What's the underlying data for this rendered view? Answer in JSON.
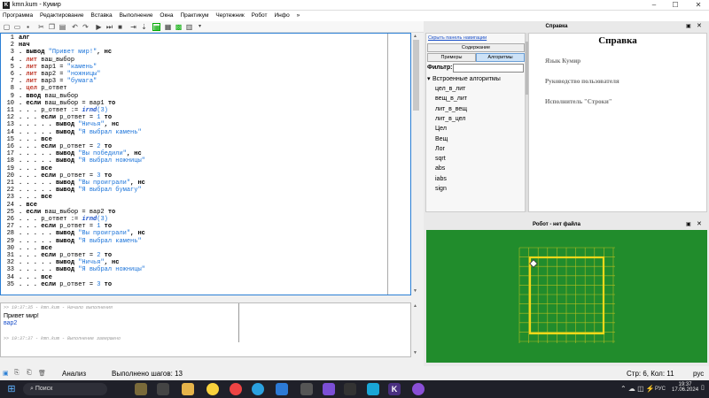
{
  "window": {
    "title": "kmn.kum - Кумир",
    "minimize": "–",
    "maximize": "☐",
    "close": "✕"
  },
  "menu": [
    "Программа",
    "Редактирование",
    "Вставка",
    "Выполнение",
    "Окна",
    "Практикум",
    "Чертежник",
    "Робот",
    "Инфо",
    "»"
  ],
  "editor": {
    "line_numbers": [
      "1",
      "2",
      "3",
      "4",
      "5",
      "6",
      "7",
      "8",
      "9",
      "10",
      "11",
      "12",
      "13",
      "14",
      "15",
      "16",
      "17",
      "18",
      "19",
      "20",
      "21",
      "22",
      "23",
      "24",
      "25",
      "26",
      "27",
      "28",
      "29",
      "30",
      "31",
      "32",
      "33",
      "34",
      "35"
    ],
    "lines": [
      [
        {
          "t": "алг",
          "c": "kw"
        }
      ],
      [
        {
          "t": "нач",
          "c": "kw"
        }
      ],
      [
        {
          "t": ". ",
          "c": "kw"
        },
        {
          "t": "вывод ",
          "c": "kw"
        },
        {
          "t": "\"Привет мир!\"",
          "c": "str"
        },
        {
          "t": ", нс",
          "c": "kw"
        }
      ],
      [
        {
          "t": ". ",
          "c": "kw"
        },
        {
          "t": "лит ",
          "c": "tp"
        },
        {
          "t": "ваш_выбор",
          "c": "tx"
        }
      ],
      [
        {
          "t": ". ",
          "c": "kw"
        },
        {
          "t": "лит ",
          "c": "tp"
        },
        {
          "t": "вар1 = ",
          "c": "tx"
        },
        {
          "t": "\"камень\"",
          "c": "str"
        }
      ],
      [
        {
          "t": ". ",
          "c": "kw"
        },
        {
          "t": "лит ",
          "c": "tp"
        },
        {
          "t": "вар2 = ",
          "c": "tx"
        },
        {
          "t": "\"ножницы\"",
          "c": "str"
        }
      ],
      [
        {
          "t": ". ",
          "c": "kw"
        },
        {
          "t": "лит ",
          "c": "tp"
        },
        {
          "t": "вар3 = ",
          "c": "tx"
        },
        {
          "t": "\"бумага\"",
          "c": "str"
        }
      ],
      [
        {
          "t": ". ",
          "c": "kw"
        },
        {
          "t": "цел ",
          "c": "tp"
        },
        {
          "t": "р_ответ",
          "c": "tx"
        }
      ],
      [
        {
          "t": ". ",
          "c": "kw"
        },
        {
          "t": "ввод ",
          "c": "kw"
        },
        {
          "t": "ваш_выбор",
          "c": "tx"
        }
      ],
      [
        {
          "t": ". ",
          "c": "kw"
        },
        {
          "t": "если ",
          "c": "kw"
        },
        {
          "t": "ваш_выбор = вар1 ",
          "c": "tx"
        },
        {
          "t": "то",
          "c": "kw"
        }
      ],
      [
        {
          "t": ". . . ",
          "c": "kw"
        },
        {
          "t": "р_ответ := ",
          "c": "tx"
        },
        {
          "t": "irnd",
          "c": "fn"
        },
        {
          "t": "(3)",
          "c": "nm"
        }
      ],
      [
        {
          "t": ". . . ",
          "c": "kw"
        },
        {
          "t": "если ",
          "c": "kw"
        },
        {
          "t": "р_ответ = ",
          "c": "tx"
        },
        {
          "t": "1 ",
          "c": "nm"
        },
        {
          "t": "то",
          "c": "kw"
        }
      ],
      [
        {
          "t": ". . . . . ",
          "c": "kw"
        },
        {
          "t": "вывод ",
          "c": "kw"
        },
        {
          "t": "\"Ничья\"",
          "c": "str"
        },
        {
          "t": ", нс",
          "c": "kw"
        }
      ],
      [
        {
          "t": ". . . . . ",
          "c": "kw"
        },
        {
          "t": "вывод ",
          "c": "kw"
        },
        {
          "t": "\"Я выбрал камень\"",
          "c": "str"
        }
      ],
      [
        {
          "t": ". . . ",
          "c": "kw"
        },
        {
          "t": "все",
          "c": "kw"
        }
      ],
      [
        {
          "t": ". . . ",
          "c": "kw"
        },
        {
          "t": "если ",
          "c": "kw"
        },
        {
          "t": "р_ответ = ",
          "c": "tx"
        },
        {
          "t": "2 ",
          "c": "nm"
        },
        {
          "t": "то",
          "c": "kw"
        }
      ],
      [
        {
          "t": ". . . . . ",
          "c": "kw"
        },
        {
          "t": "вывод ",
          "c": "kw"
        },
        {
          "t": "\"Вы победили\"",
          "c": "str"
        },
        {
          "t": ", нс",
          "c": "kw"
        }
      ],
      [
        {
          "t": ". . . . . ",
          "c": "kw"
        },
        {
          "t": "вывод ",
          "c": "kw"
        },
        {
          "t": "\"Я выбрал ножницы\"",
          "c": "str"
        }
      ],
      [
        {
          "t": ". . . ",
          "c": "kw"
        },
        {
          "t": "все",
          "c": "kw"
        }
      ],
      [
        {
          "t": ". . . ",
          "c": "kw"
        },
        {
          "t": "если ",
          "c": "kw"
        },
        {
          "t": "р_ответ = ",
          "c": "tx"
        },
        {
          "t": "3 ",
          "c": "nm"
        },
        {
          "t": "то",
          "c": "kw"
        }
      ],
      [
        {
          "t": ". . . . . ",
          "c": "kw"
        },
        {
          "t": "вывод ",
          "c": "kw"
        },
        {
          "t": "\"Вы проиграли\"",
          "c": "str"
        },
        {
          "t": ", нс",
          "c": "kw"
        }
      ],
      [
        {
          "t": ". . . . . ",
          "c": "kw"
        },
        {
          "t": "вывод ",
          "c": "kw"
        },
        {
          "t": "\"Я выбрал бумагу\"",
          "c": "str"
        }
      ],
      [
        {
          "t": ". . . ",
          "c": "kw"
        },
        {
          "t": "все",
          "c": "kw"
        }
      ],
      [
        {
          "t": ". ",
          "c": "kw"
        },
        {
          "t": "все",
          "c": "kw"
        }
      ],
      [
        {
          "t": ". ",
          "c": "kw"
        },
        {
          "t": "если ",
          "c": "kw"
        },
        {
          "t": "ваш_выбор = вар2 ",
          "c": "tx"
        },
        {
          "t": "то",
          "c": "kw"
        }
      ],
      [
        {
          "t": ". . . ",
          "c": "kw"
        },
        {
          "t": "р_ответ := ",
          "c": "tx"
        },
        {
          "t": "irnd",
          "c": "fn"
        },
        {
          "t": "(3)",
          "c": "nm"
        }
      ],
      [
        {
          "t": ". . . ",
          "c": "kw"
        },
        {
          "t": "если ",
          "c": "kw"
        },
        {
          "t": "р_ответ = ",
          "c": "tx"
        },
        {
          "t": "1 ",
          "c": "nm"
        },
        {
          "t": "то",
          "c": "kw"
        }
      ],
      [
        {
          "t": ". . . . . ",
          "c": "kw"
        },
        {
          "t": "вывод ",
          "c": "kw"
        },
        {
          "t": "\"Вы проиграли\"",
          "c": "str"
        },
        {
          "t": ", нс",
          "c": "kw"
        }
      ],
      [
        {
          "t": ". . . . . ",
          "c": "kw"
        },
        {
          "t": "вывод ",
          "c": "kw"
        },
        {
          "t": "\"Я выбрал камень\"",
          "c": "str"
        }
      ],
      [
        {
          "t": ". . . ",
          "c": "kw"
        },
        {
          "t": "все",
          "c": "kw"
        }
      ],
      [
        {
          "t": ". . . ",
          "c": "kw"
        },
        {
          "t": "если ",
          "c": "kw"
        },
        {
          "t": "р_ответ = ",
          "c": "tx"
        },
        {
          "t": "2 ",
          "c": "nm"
        },
        {
          "t": "то",
          "c": "kw"
        }
      ],
      [
        {
          "t": ". . . . . ",
          "c": "kw"
        },
        {
          "t": "вывод ",
          "c": "kw"
        },
        {
          "t": "\"Ничья\"",
          "c": "str"
        },
        {
          "t": ", нс",
          "c": "kw"
        }
      ],
      [
        {
          "t": ". . . . . ",
          "c": "kw"
        },
        {
          "t": "вывод ",
          "c": "kw"
        },
        {
          "t": "\"Я выбрал ножницы\"",
          "c": "str"
        }
      ],
      [
        {
          "t": ". . . ",
          "c": "kw"
        },
        {
          "t": "все",
          "c": "kw"
        }
      ],
      [
        {
          "t": ". . . ",
          "c": "kw"
        },
        {
          "t": "если ",
          "c": "kw"
        },
        {
          "t": "р_ответ = ",
          "c": "tx"
        },
        {
          "t": "3 ",
          "c": "nm"
        },
        {
          "t": "то",
          "c": "kw"
        }
      ]
    ]
  },
  "console": {
    "log_start": ">> 19:37:35 - kmn.kum - Начало выполнения",
    "output_1": "Привет мир!",
    "output_2": "вар2",
    "log_end": ">> 19:37:37 - kmn.kum - Выполнение завершено"
  },
  "status": {
    "mode": "Анализ",
    "steps": "Выполнено шагов: 13",
    "cursor": "Стр: 6, Кол: 11",
    "lang": "рус"
  },
  "help_dock": {
    "header": "Справка"
  },
  "navigation": {
    "hide_link": "Скрыть панель навигации",
    "contents_btn": "Содержание",
    "examples_btn": "Примеры",
    "algorithms_btn": "Алгоритмы",
    "filter_label": "Фильтр:",
    "tree_root": "Встроенные алгоритмы",
    "tree_items": [
      "цел_в_лит",
      "вещ_в_лит",
      "лит_в_вещ",
      "лит_в_цел",
      "Цел",
      "Вещ",
      "Лог",
      "sqrt",
      "abs",
      "iabs",
      "sign"
    ]
  },
  "help": {
    "title": "Справка",
    "items": [
      "Язык Кумир",
      "Руководство пользователя",
      "Исполнитель \"Строки\""
    ]
  },
  "robot": {
    "header": "Робот - нет файла",
    "field_color": "#218c2c",
    "wall_color": "#e6d31a"
  },
  "taskbar": {
    "search": "Поиск",
    "time": "19:37",
    "date": "17.06.2024",
    "lang": "РУС"
  },
  "colors": {
    "accent": "#2a7fd5",
    "taskbar": "#1f2029"
  }
}
